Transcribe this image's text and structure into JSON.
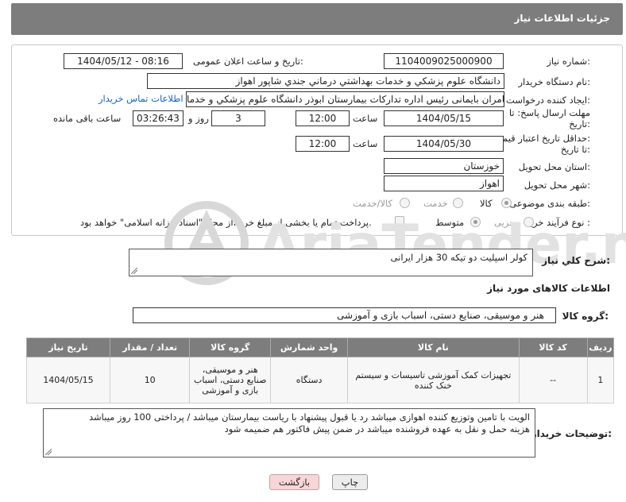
{
  "header": {
    "title": "جزئیات اطلاعات نیاز"
  },
  "fields": {
    "need_number_label": "شماره نیاز:",
    "need_number": "1104009025000900",
    "announce_label": "تاریخ و ساعت اعلان عمومی:",
    "announce_value": "1404/05/12 - 08:16",
    "buyer_org_label": "نام دستگاه خریدار:",
    "buyer_org": "دانشگاه علوم پزشکي و خدمات بهداشتي درماني جندي شاپور اهواز",
    "creator_label": "ایجاد کننده درخواست:",
    "creator": "کامران بایمانی رئیس اداره تدارکات بیمارستان ابوذر  دانشگاه علوم پزشکي و خدما",
    "contact_link": "اطلاعات تماس خریدار",
    "deadline_label_1": "مهلت ارسال پاسخ: تا",
    "deadline_label_2": "تاریخ:",
    "deadline_date": "1404/05/15",
    "time_label": "ساعت",
    "deadline_time": "12:00",
    "days_value": "3",
    "days_label": "روز و",
    "remaining_time": "03:26:43",
    "remaining_label": "ساعت باقی مانده",
    "validity_label_1": "حداقل تاریخ اعتبار قیمت:",
    "validity_label_2": "تا تاریخ:",
    "validity_date": "1404/05/30",
    "validity_time_label": "ساعت",
    "validity_time": "12:00",
    "province_label": "استان محل تحویل:",
    "province": "خوزستان",
    "city_label": "شهر محل تحویل:",
    "city": "اهواز",
    "category_label": "طبقه بندی موضوعی:",
    "category_options": [
      "کالا",
      "خدمت",
      "کالا/خدمت"
    ],
    "process_label": "نوع فرآیند خرید :",
    "process_options": [
      "جزیی",
      "متوسط"
    ],
    "payment_note": "پرداخت تمام یا بخشی از مبلغ خرید،از محل \"اسناد خزانه اسلامی\" خواهد بود."
  },
  "summary": {
    "label": "شرح کلي نياز:",
    "text": "کولر اسپلیت دو تیکه 30 هزار ایرانی"
  },
  "goods": {
    "section_title": "اطلاعات کالاهای مورد نیاز",
    "group_label": "گروه کالا:",
    "group_value": "هنر و موسیقی، صنایع دستی، اسباب بازی و آموزشی",
    "columns": [
      "ردیف",
      "کد کالا",
      "نام کالا",
      "واحد شمارش",
      "گروه کالا",
      "تعداد / مقدار",
      "تاریخ نیاز"
    ],
    "rows": [
      {
        "row": "1",
        "code": "--",
        "name": "تجهیزات کمک آموزشی تاسیسات و سیستم خنک کننده",
        "unit": "دستگاه",
        "group": "هنر و موسیقی، صنایع دستی، اسباب بازی و آموزشی",
        "qty": "10",
        "date": "1404/05/15"
      }
    ]
  },
  "buyer_notes": {
    "label": "توضیحات خریدار:",
    "line1": "الویت با تامین وتوزیع کننده اهوازی  میباشد رد یا قبول پیشنهاد با ریاست بیمارستان میباشد / پرداختی 100 روز میباشد",
    "line2": "هزینه حمل و نقل به عهده فروشنده میباشد  در ضمن پیش فاکتور هم ضمیمه شود"
  },
  "buttons": {
    "print": "چاپ",
    "back": "بازگشت"
  },
  "watermark": {
    "text": "AriaTender.net"
  },
  "colors": {
    "header_bg": "#7d7d7d",
    "link": "#1565c0",
    "back_btn_bg": "#f6d6d6"
  }
}
